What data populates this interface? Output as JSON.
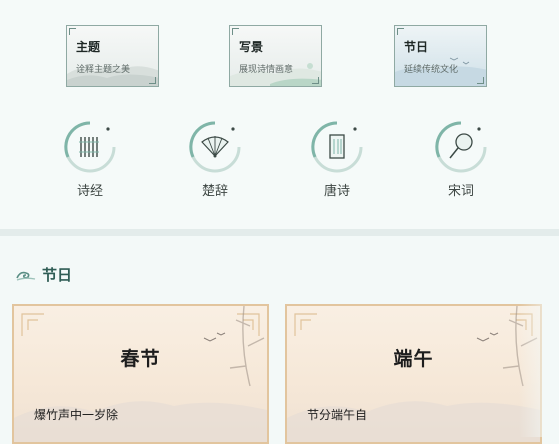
{
  "categories": [
    {
      "title": "主题",
      "subtitle": "诠释主题之美"
    },
    {
      "title": "写景",
      "subtitle": "展现诗情画意"
    },
    {
      "title": "节日",
      "subtitle": "延续传统文化"
    }
  ],
  "classics": [
    {
      "label": "诗经",
      "icon": "bamboo-scroll-icon"
    },
    {
      "label": "楚辞",
      "icon": "folding-fan-icon"
    },
    {
      "label": "唐诗",
      "icon": "book-icon"
    },
    {
      "label": "宋词",
      "icon": "round-fan-icon"
    }
  ],
  "section": {
    "title": "节日",
    "icon": "cloud-swirl-icon"
  },
  "festivals": [
    {
      "name": "春节",
      "line": "爆竹声中一岁除"
    },
    {
      "name": "端午",
      "line": "节分端午自"
    }
  ],
  "colors": {
    "accent": "#2f5d55",
    "ring": "#7fb5a8",
    "card_border": "#e2c59e"
  }
}
